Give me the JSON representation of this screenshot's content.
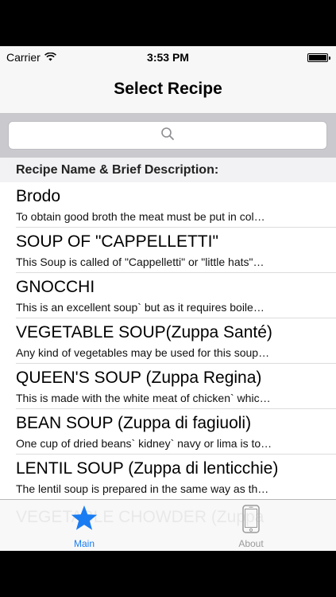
{
  "status_bar": {
    "carrier": "Carrier",
    "time": "3:53 PM",
    "battery_level": 1.0
  },
  "navigation": {
    "title": "Select Recipe"
  },
  "search": {
    "placeholder": "",
    "icon": "search-icon"
  },
  "section_header": "Recipe Name & Brief Description:",
  "recipes": [
    {
      "name": "Brodo",
      "desc": "To obtain good broth the meat must be put in col…"
    },
    {
      "name": "SOUP OF \"CAPPELLETTI\"",
      "desc": "This Soup is called of \"Cappelletti\" or \"little hats\"…"
    },
    {
      "name": "GNOCCHI",
      "desc": " This is an excellent soup` but as it requires boile…"
    },
    {
      "name": "VEGETABLE SOUP(Zuppa Santé)",
      "desc": "Any kind of vegetables may be used for this soup…"
    },
    {
      "name": "QUEEN'S SOUP (Zuppa Regina)",
      "desc": "This is made with the white meat of chicken` whic…"
    },
    {
      "name": "BEAN SOUP (Zuppa di fagiuoli)",
      "desc": "One cup of dried beans` kidney` navy or lima is to…"
    },
    {
      "name": "LENTIL SOUP (Zuppa di lenticchie)",
      "desc": "The lentil soup is prepared in the same way as th…"
    }
  ],
  "partially_hidden_row": "VEGETABLE CHOWDER (Zuppa",
  "tabs": [
    {
      "label": "Main",
      "icon": "star-icon",
      "selected": true,
      "color": "#1a7cf2"
    },
    {
      "label": "About",
      "icon": "phone-icon",
      "selected": false,
      "color": "#9a9a9a"
    }
  ],
  "colors": {
    "accent": "#1a7cf2",
    "inactive": "#9a9a9a",
    "search_bar_bg": "#c9c9ce"
  }
}
